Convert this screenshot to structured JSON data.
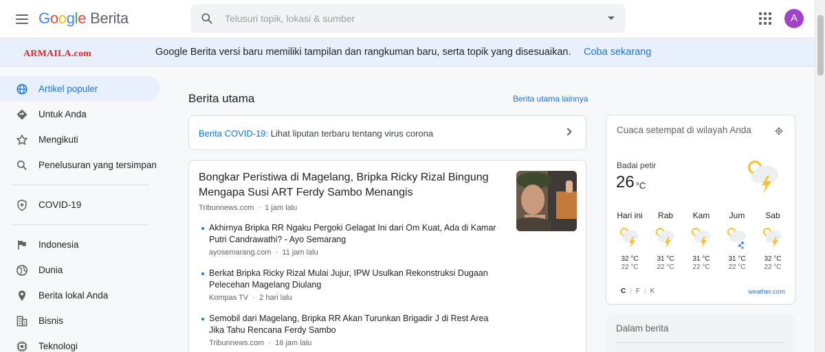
{
  "header": {
    "logo_google": [
      "G",
      "o",
      "o",
      "g",
      "l",
      "e"
    ],
    "logo_product": "Berita",
    "search_placeholder": "Telusuri topik, lokasi & sumber",
    "avatar_letter": "A"
  },
  "banner": {
    "watermark": "ARMAILA.com",
    "text": "Google Berita versi baru memiliki tampilan dan rangkuman baru, serta topik yang disesuaikan.",
    "link": "Coba sekarang"
  },
  "sidebar": {
    "items": [
      {
        "label": "Artikel populer",
        "icon": "globe-icon"
      },
      {
        "label": "Untuk Anda",
        "icon": "diamond-icon"
      },
      {
        "label": "Mengikuti",
        "icon": "star-icon"
      },
      {
        "label": "Penelusuran yang tersimpan",
        "icon": "search-icon"
      },
      {
        "label": "COVID-19",
        "icon": "shield-icon"
      },
      {
        "label": "Indonesia",
        "icon": "flag-icon"
      },
      {
        "label": "Dunia",
        "icon": "world-icon"
      },
      {
        "label": "Berita lokal Anda",
        "icon": "location-pin-icon"
      },
      {
        "label": "Bisnis",
        "icon": "building-icon"
      },
      {
        "label": "Teknologi",
        "icon": "chip-icon"
      }
    ]
  },
  "main": {
    "section_title": "Berita utama",
    "more_link": "Berita utama lainnya",
    "covid": {
      "highlight": "Berita COVID-19:",
      "text": " Lihat liputan terbaru tentang virus corona"
    },
    "story": {
      "headline": "Bongkar Peristiwa di Magelang, Bripka Ricky Rizal Bingung Mengapa Susi ART Ferdy Sambo Menangis",
      "source": "Tribunnews.com",
      "time": "1 jam lalu",
      "related": [
        {
          "title": "Akhirnya Bripka RR Ngaku Pergoki Gelagat Ini dari Om Kuat, Ada di Kamar Putri Candrawathi? - Ayo Semarang",
          "source": "ayosemarang.com",
          "time": "11 jam lalu"
        },
        {
          "title": "Berkat Bripka Ricky Rizal Mulai Jujur, IPW Usulkan Rekonstruksi Dugaan Pelecehan Magelang Diulang",
          "source": "Kompas TV",
          "time": "2 hari lalu"
        },
        {
          "title": "Semobil dari Magelang, Bripka RR Akan Turunkan Brigadir J di Rest Area Jika Tahu Rencana Ferdy Sambo",
          "source": "Tribunnews.com",
          "time": "16 jam lalu"
        }
      ]
    }
  },
  "weather": {
    "title": "Cuaca setempat di wilayah Anda",
    "condition": "Badai petir",
    "temp": "26",
    "unit": "°C",
    "days": [
      {
        "name": "Hari ini",
        "hi": "32 °C",
        "lo": "22 °C",
        "icon": "thunderstorm-icon"
      },
      {
        "name": "Rab",
        "hi": "31 °C",
        "lo": "22 °C",
        "icon": "thunderstorm-icon"
      },
      {
        "name": "Kam",
        "hi": "31 °C",
        "lo": "22 °C",
        "icon": "thunderstorm-icon"
      },
      {
        "name": "Jum",
        "hi": "31 °C",
        "lo": "22 °C",
        "icon": "rain-icon"
      },
      {
        "name": "Sab",
        "hi": "32 °C",
        "lo": "22 °C",
        "icon": "thunderstorm-icon"
      }
    ],
    "units": [
      "C",
      "F",
      "K"
    ],
    "source": "weather.com"
  },
  "in_news": {
    "title": "Dalam berita"
  },
  "colors": {
    "accent": "#1a73e8",
    "active_bg": "#e8f0fe",
    "avatar": "#a142c8",
    "watermark": "#e3262d"
  }
}
